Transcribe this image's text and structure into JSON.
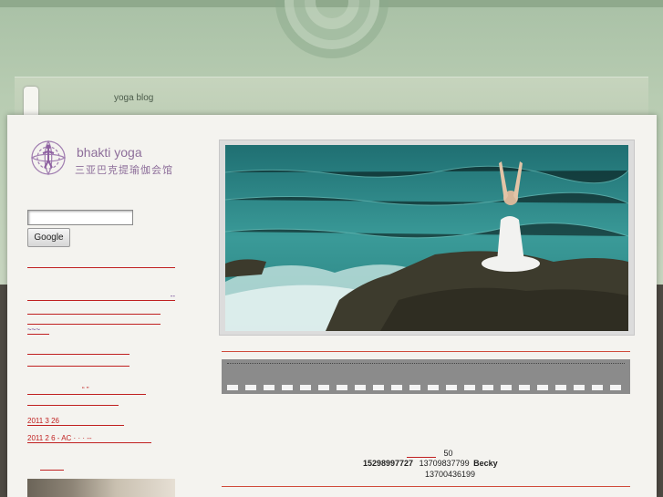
{
  "nav": {
    "link": "yoga blog"
  },
  "logo": {
    "title_en": "bhakti yoga",
    "title_cn": "三亚巴克提瑜伽会馆"
  },
  "search": {
    "placeholder": "",
    "button_label": "Google"
  },
  "sidebar": {
    "links": [
      {
        "text": ""
      },
      {
        "text": "-- "
      },
      {
        "text": ""
      },
      {
        "text": "~~~"
      },
      {
        "text": ""
      },
      {
        "text": ""
      },
      {
        "text": "“ ”"
      },
      {
        "text": ""
      },
      {
        "text": "2011 3 26"
      },
      {
        "text": "2011 2 6 - AC · · · --"
      },
      {
        "text": ""
      }
    ]
  },
  "contact": {
    "line1_value": "50",
    "phone1": "15298997727",
    "phone2": "13709837799",
    "name": "Becky",
    "phone3": "13700436199"
  },
  "colors": {
    "accent": "#c02020",
    "logo": "#8d6e9a",
    "page_bg": "#f4f3ef"
  }
}
